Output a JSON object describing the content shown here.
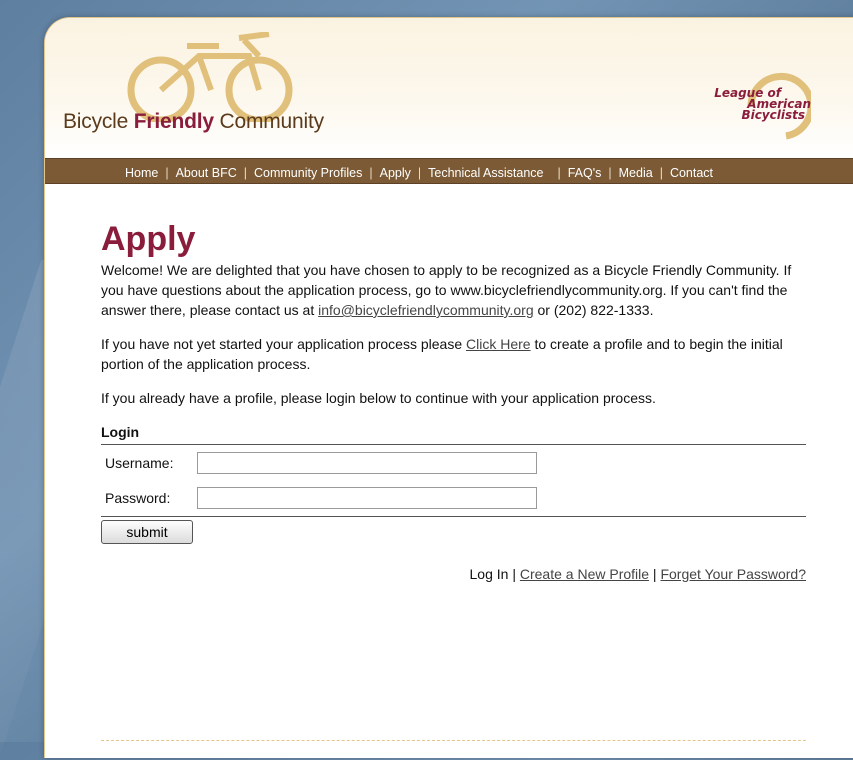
{
  "logo": {
    "part1": "Bicycle ",
    "part2": "Friendly",
    "part3": " Community"
  },
  "league": {
    "line1": "League of",
    "line2": "American",
    "line3": "Bicyclists"
  },
  "nav": {
    "items": [
      "Home",
      "About BFC",
      "Community Profiles",
      "Apply",
      "Technical Assistance",
      "FAQ's",
      "Media",
      "Contact"
    ]
  },
  "main": {
    "title": "Apply",
    "intro": "Welcome! We are delighted that you have chosen to apply to be recognized as a Bicycle Friendly Community. If you have questions about the application process, go to www.bicyclefriendlycommunity.org. If you can't find the answer there, please contact us at ",
    "email": "info@bicyclefriendlycommunity.org",
    "phone_text": " or (202) 822-1333.",
    "start_before": "If you have not yet started your application process please ",
    "click_here": "Click Here",
    "start_after": " to create a profile and to begin the initial portion of the application process.",
    "profile_text": "If you already have a profile, please login below to continue with your application process."
  },
  "login": {
    "heading": "Login",
    "username_label": "Username:",
    "username_value": "",
    "password_label": "Password:",
    "password_value": "",
    "submit": "submit"
  },
  "footer_links": {
    "login": "Log In",
    "sep": " | ",
    "create": "Create a New Profile",
    "forgot": "Forget Your Password?"
  },
  "colors": {
    "accent": "#8a1d3c",
    "nav_bg": "#7b5a35",
    "logo_gold": "#e0c07a"
  }
}
